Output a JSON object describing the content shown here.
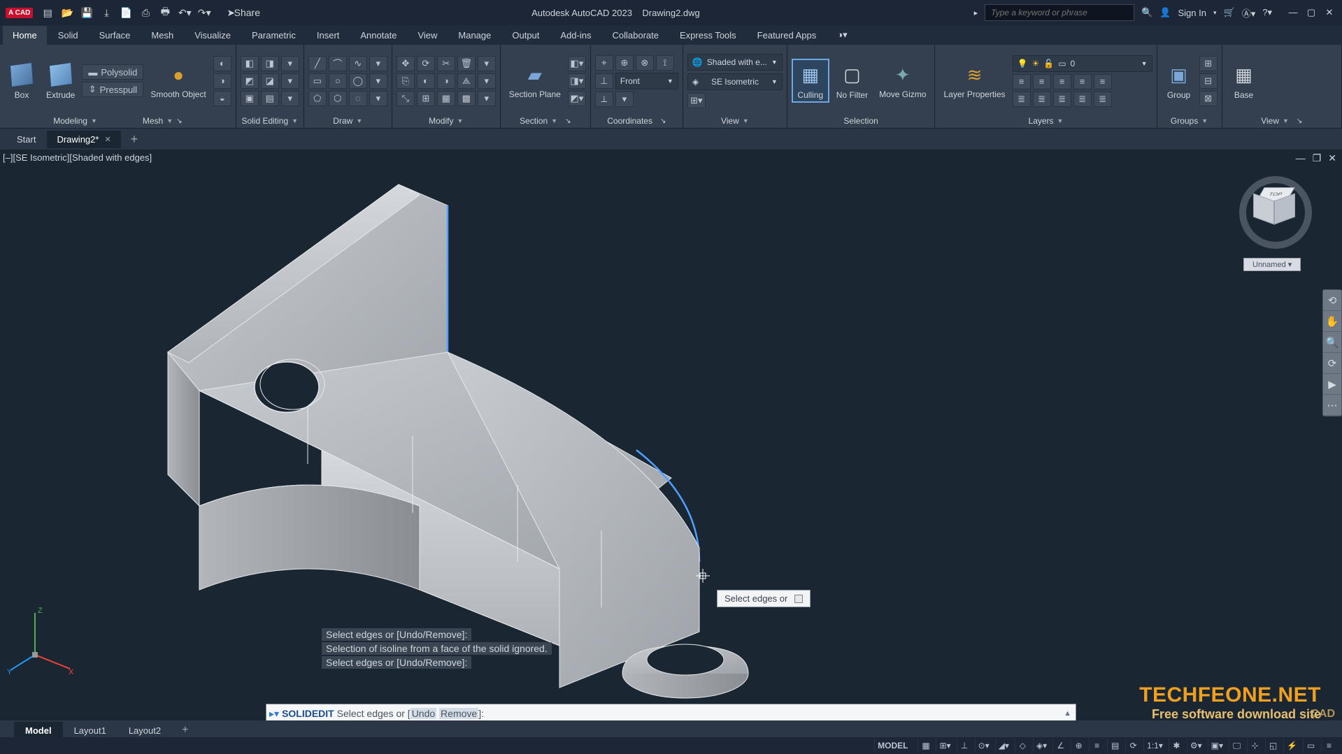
{
  "title": {
    "app": "Autodesk AutoCAD 2023",
    "doc": "Drawing2.dwg"
  },
  "logo": "A CAD",
  "qat_share": "Share",
  "search_placeholder": "Type a keyword or phrase",
  "signin": "Sign In",
  "ribbon_tabs": [
    "Home",
    "Solid",
    "Surface",
    "Mesh",
    "Visualize",
    "Parametric",
    "Insert",
    "Annotate",
    "View",
    "Manage",
    "Output",
    "Add-ins",
    "Collaborate",
    "Express Tools",
    "Featured Apps"
  ],
  "panels": {
    "modeling": {
      "title": "Modeling",
      "box": "Box",
      "extrude": "Extrude",
      "polysolid": "Polysolid",
      "presspull": "Presspull",
      "smooth": "Smooth Object"
    },
    "mesh": {
      "title": "Mesh"
    },
    "solidedit": {
      "title": "Solid Editing"
    },
    "draw": {
      "title": "Draw"
    },
    "modify": {
      "title": "Modify"
    },
    "section": {
      "title": "Section",
      "plane": "Section Plane"
    },
    "coordinates": {
      "title": "Coordinates",
      "front": "Front"
    },
    "view": {
      "title": "View",
      "vs": "Shaded with e...",
      "iso": "SE Isometric"
    },
    "selection": {
      "title": "Selection",
      "culling": "Culling",
      "nofilter": "No Filter",
      "gizmo": "Move Gizmo"
    },
    "layers": {
      "title": "Layers",
      "props": "Layer Properties",
      "layer0": "0"
    },
    "groups": {
      "title": "Groups",
      "group": "Group"
    },
    "viewpanel": {
      "title": "View",
      "base": "Base"
    }
  },
  "file_tabs": {
    "start": "Start",
    "drawing": "Drawing2*"
  },
  "viewport_label": "[–][SE Isometric][Shaded with edges]",
  "viewcube": {
    "top": "TOP",
    "tag": "Unnamed"
  },
  "tooltip": "Select edges or",
  "history": [
    "Select edges or [Undo/Remove]:",
    "Selection of isoline from a face of the solid ignored.",
    "Select edges or [Undo/Remove]:"
  ],
  "cmd": {
    "name": "SOLIDEDIT",
    "prompt": "Select edges or [",
    "u": "Undo",
    "r": "Remove",
    "end": "]:"
  },
  "layouts": [
    "Model",
    "Layout1",
    "Layout2"
  ],
  "status_model": "MODEL",
  "status_scale": "1:1",
  "watermark": {
    "t1": "TECHFEONE.NET",
    "t2": "Free software download site"
  },
  "cadstamp": "CAD"
}
